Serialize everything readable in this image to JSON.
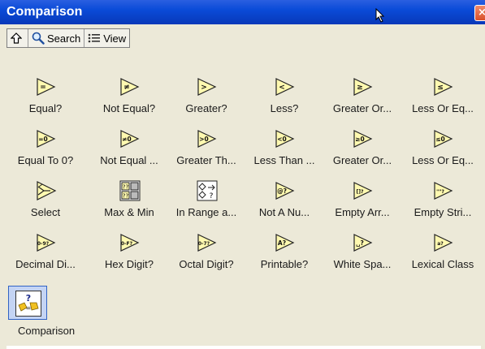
{
  "window": {
    "title": "Comparison"
  },
  "toolbar": {
    "up_icon": "up-arrow-icon",
    "search_label": "Search",
    "view_label": "View"
  },
  "palette": {
    "items": [
      {
        "label": "Equal?",
        "glyph": "="
      },
      {
        "label": "Not Equal?",
        "glyph": "≠"
      },
      {
        "label": "Greater?",
        "glyph": ">"
      },
      {
        "label": "Less?",
        "glyph": "<"
      },
      {
        "label": "Greater Or...",
        "glyph": "≥"
      },
      {
        "label": "Less Or Eq...",
        "glyph": "≤"
      },
      {
        "label": "Equal To 0?",
        "glyph": "=0"
      },
      {
        "label": "Not Equal ...",
        "glyph": "≠0"
      },
      {
        "label": "Greater Th...",
        "glyph": ">0"
      },
      {
        "label": "Less Than ...",
        "glyph": "<0"
      },
      {
        "label": "Greater Or...",
        "glyph": "≥0"
      },
      {
        "label": "Less Or Eq...",
        "glyph": "≤0"
      },
      {
        "label": "Select",
        "glyph": "select"
      },
      {
        "label": "Max & Min",
        "glyph": "maxmin"
      },
      {
        "label": "In Range a...",
        "glyph": "range"
      },
      {
        "label": "Not A Nu...",
        "glyph": "@?"
      },
      {
        "label": "Empty Arr...",
        "glyph": "[]?"
      },
      {
        "label": "Empty Stri...",
        "glyph": "\"\"?"
      },
      {
        "label": "Decimal Di...",
        "glyph": "0-9?"
      },
      {
        "label": "Hex Digit?",
        "glyph": "0-F?"
      },
      {
        "label": "Octal Digit?",
        "glyph": "0-7?"
      },
      {
        "label": "Printable?",
        "glyph": "A?"
      },
      {
        "label": "White Spa...",
        "glyph": "␣?"
      },
      {
        "label": "Lexical Class",
        "glyph": "lex"
      }
    ],
    "selected": {
      "label": "Comparison",
      "icon": "comparison-subpalette-icon"
    }
  },
  "colors": {
    "titlebar": "#0a4bd8",
    "panel_bg": "#ece9d8",
    "icon_fill": "#fff9b0",
    "selection": "#c4d4f4"
  }
}
